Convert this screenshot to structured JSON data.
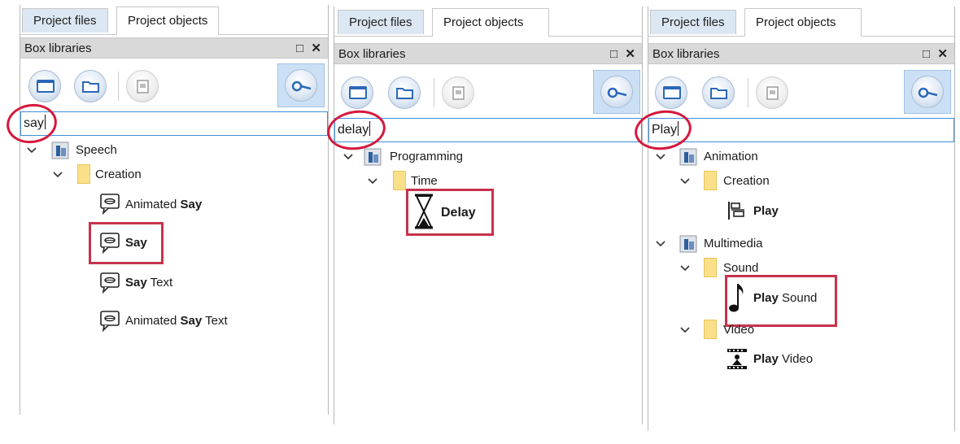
{
  "tabs": {
    "files": "Project files",
    "objects": "Project objects"
  },
  "dock": {
    "title": "Box libraries",
    "float_icon": "float-icon",
    "close_icon": "close-icon"
  },
  "toolbar": {
    "buttons": [
      "new-library-icon",
      "open-library-icon",
      "disabled-library-icon",
      "search-toggle-icon"
    ]
  },
  "colors": {
    "highlight": "#c7324b",
    "circle": "#d6183c",
    "selected_tab": "#dbe7f3",
    "dock_bar": "#d9d9d9"
  },
  "panels": [
    {
      "search": "say",
      "library": "Speech",
      "folder": "Creation",
      "items": [
        {
          "pre": "Animated ",
          "bold": "Say",
          "post": ""
        },
        {
          "pre": "",
          "bold": "Say",
          "post": ""
        },
        {
          "pre": "",
          "bold": "Say",
          "post": " Text"
        },
        {
          "pre": "Animated ",
          "bold": "Say",
          "post": " Text"
        }
      ]
    },
    {
      "search": "delay",
      "library": "Programming",
      "folder": "Time",
      "items": [
        {
          "pre": "",
          "bold": "Delay",
          "post": ""
        }
      ]
    },
    {
      "search": "Play",
      "library1": "Animation",
      "folder1": "Creation",
      "item1": {
        "bold": "Play",
        "post": ""
      },
      "library2": "Multimedia",
      "folder2": "Sound",
      "item2": {
        "bold": "Play",
        "post": " Sound"
      },
      "folder3": "Video",
      "item3": {
        "bold": "Play",
        "post": " Video"
      }
    }
  ]
}
